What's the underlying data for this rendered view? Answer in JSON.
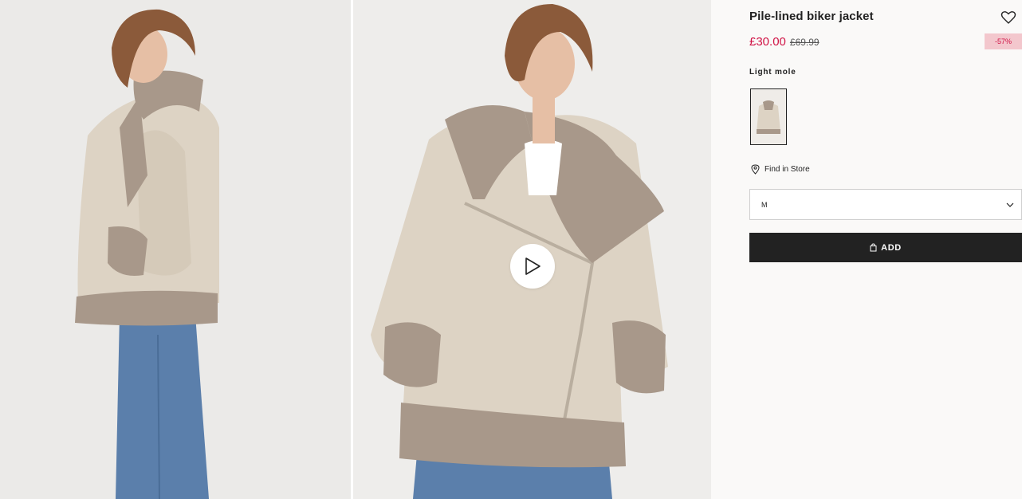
{
  "product": {
    "title": "Pile-lined biker jacket",
    "price_current": "£30.00",
    "price_original": "£69.99",
    "discount_badge": "-57%",
    "color_name": "Light mole"
  },
  "store": {
    "find_label": "Find in Store"
  },
  "size": {
    "selected": "M"
  },
  "cart": {
    "add_label": "ADD"
  },
  "colors": {
    "sale_red": "#d01345",
    "badge_bg": "#f3c7cd",
    "button_bg": "#222222",
    "jacket": "#ddd3c4",
    "fur": "#a8988a",
    "denim": "#5b7fab"
  },
  "icons": [
    "heart-icon",
    "pin-icon",
    "chevron-down-icon",
    "bag-icon",
    "play-icon"
  ]
}
